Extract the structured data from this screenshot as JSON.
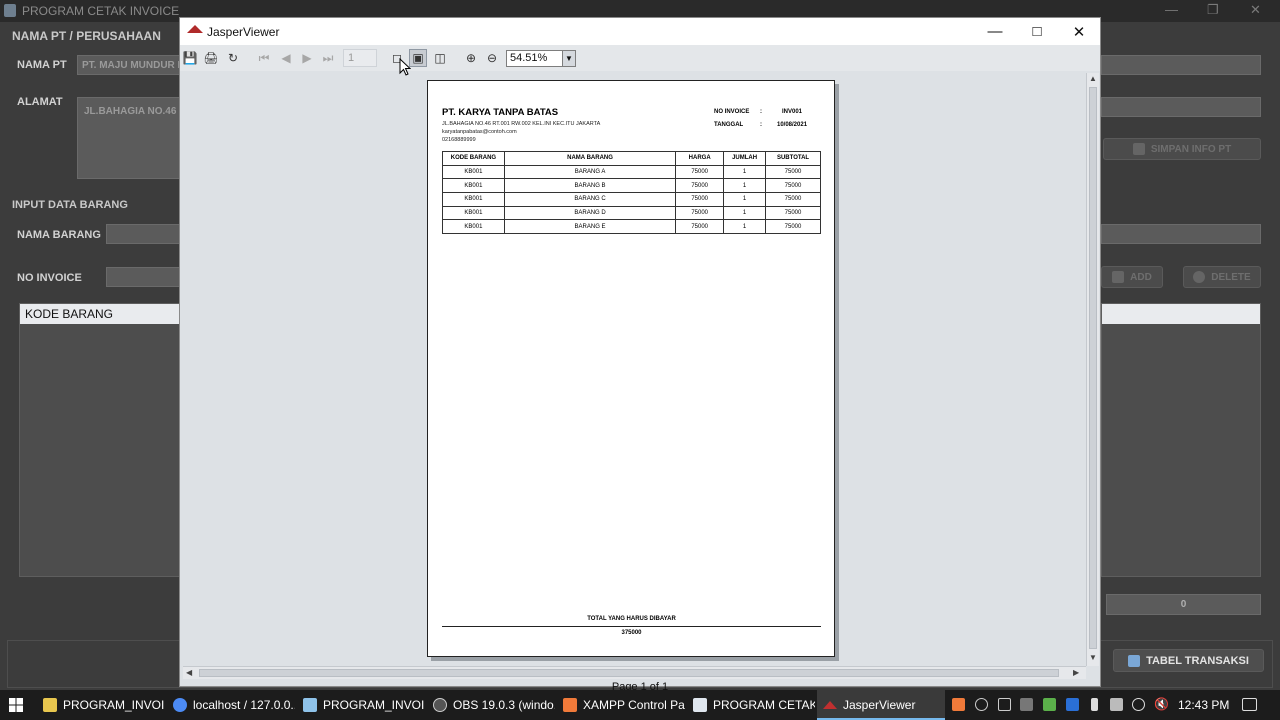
{
  "bg_window": {
    "title": "PROGRAM CETAK INVOICE",
    "section_company": "NAMA PT / PERUSAHAAN",
    "label_company_name": "NAMA PT",
    "company_name_value": "PT. MAJU MUNDUR K",
    "label_address": "ALAMAT",
    "address_value": "JL.BAHAGIA NO.46",
    "save_info_button": "SIMPAN INFO PT",
    "section_items": "INPUT DATA BARANG",
    "label_item_name": "NAMA BARANG",
    "label_invoice_no": "NO INVOICE",
    "add_button": "ADD",
    "delete_button": "DELETE",
    "table_header_code": "KODE BARANG",
    "total_field_value": "0",
    "transaction_table_button": "TABEL TRANSAKSI"
  },
  "viewer": {
    "title": "JasperViewer",
    "page_number": "1",
    "zoom_level": "54.51%",
    "page_status": "Page 1 of 1"
  },
  "report": {
    "company": "PT. KARYA TANPA BATAS",
    "address": "JL.BAHAGIA NO.46 RT.001 RW.002 KEL.INI KEC.ITU JAKARTA",
    "email": "karyatanpabatas@contoh.com",
    "phone": "02168889999",
    "invoice_label": "NO INVOICE",
    "invoice_sep": ":",
    "invoice_no": "INV001",
    "date_label": "TANGGAL",
    "date_sep": ":",
    "date": "10/08/2021",
    "columns": [
      "KODE BARANG",
      "NAMA BARANG",
      "HARGA",
      "JUMLAH",
      "SUBTOTAL"
    ],
    "rows": [
      [
        "KB001",
        "BARANG A",
        "75000",
        "1",
        "75000"
      ],
      [
        "KB001",
        "BARANG B",
        "75000",
        "1",
        "75000"
      ],
      [
        "KB001",
        "BARANG C",
        "75000",
        "1",
        "75000"
      ],
      [
        "KB001",
        "BARANG D",
        "75000",
        "1",
        "75000"
      ],
      [
        "KB001",
        "BARANG E",
        "75000",
        "1",
        "75000"
      ]
    ],
    "total_label": "TOTAL YANG HARUS DIBAYAR",
    "total_value": "375000"
  },
  "taskbar": {
    "items": [
      "PROGRAM_INVOICE",
      "localhost / 127.0.0....",
      "PROGRAM_INVOIC...",
      "OBS 19.0.3 (windo...",
      "XAMPP Control Pa...",
      "PROGRAM CETAK I...",
      "JasperViewer"
    ],
    "clock": "12:43 PM"
  }
}
